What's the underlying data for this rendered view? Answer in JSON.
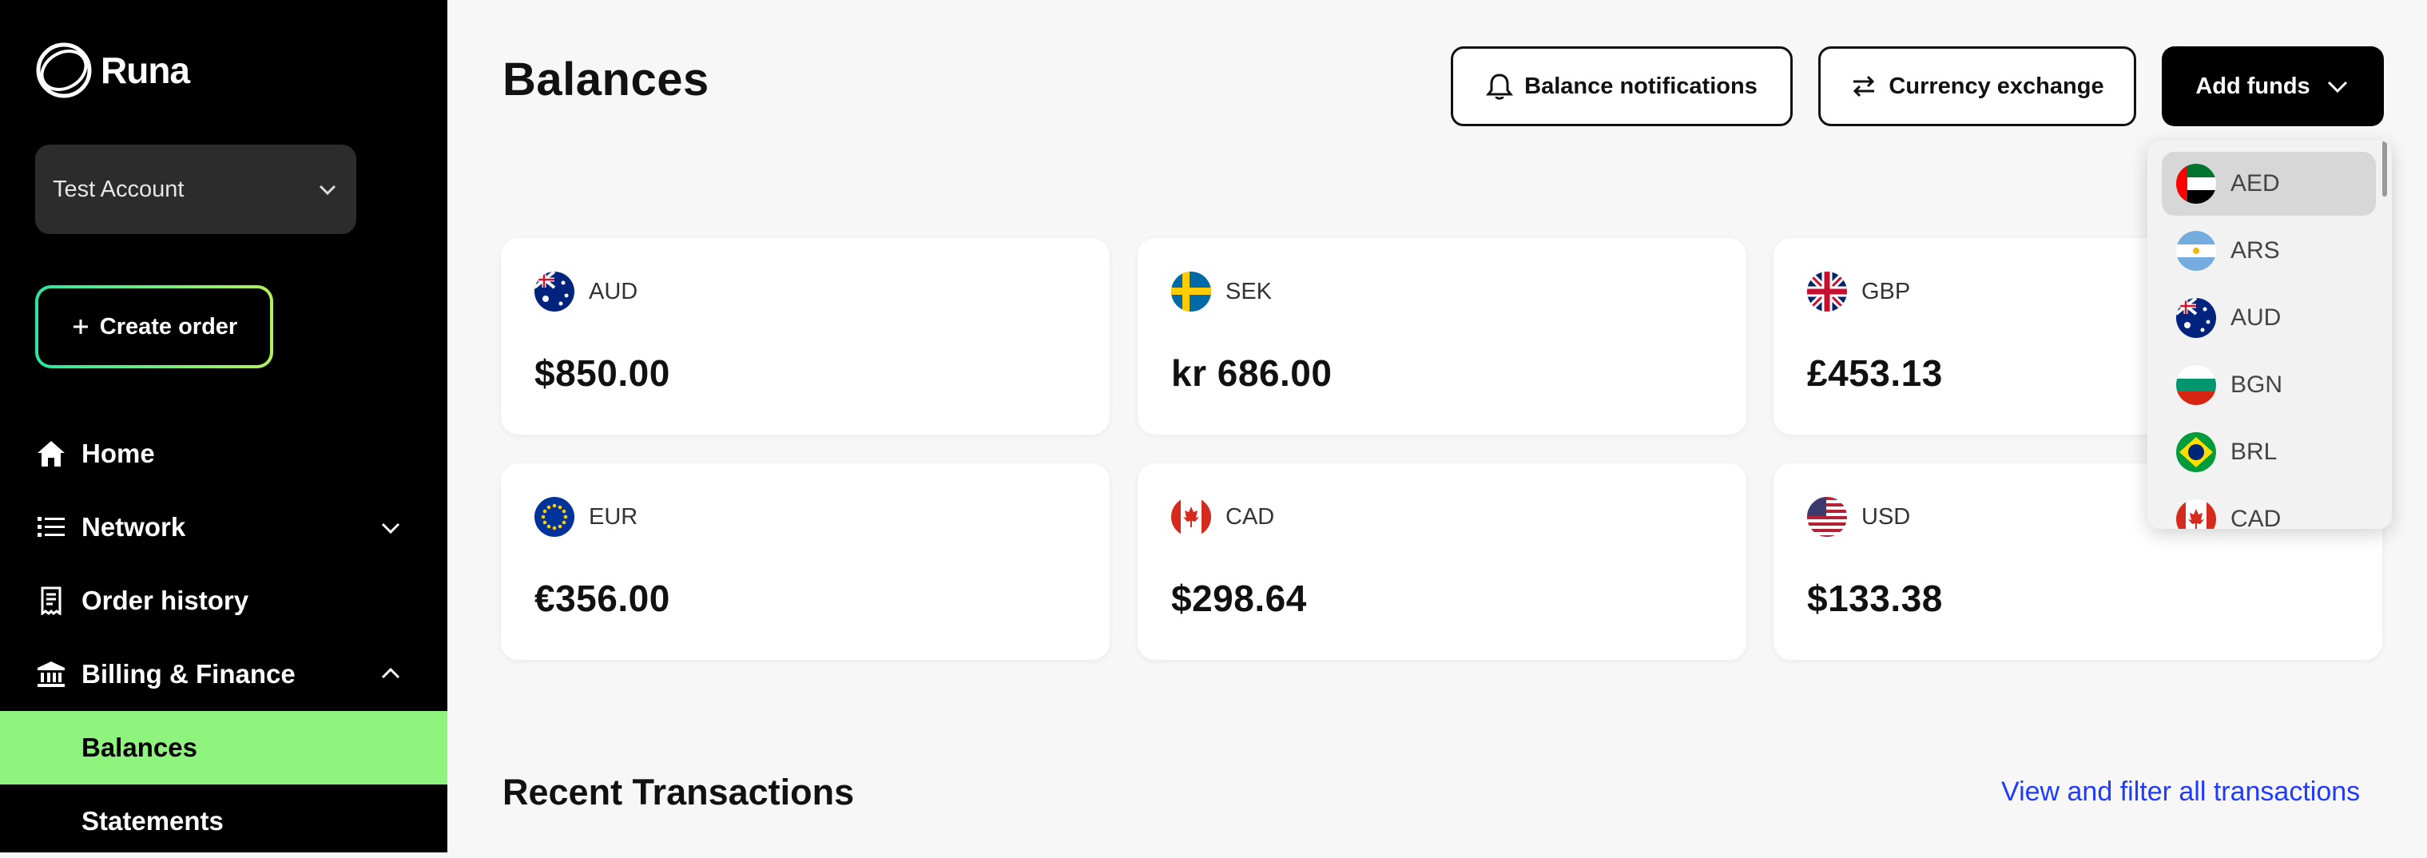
{
  "brand": {
    "name": "Runa"
  },
  "account": {
    "selected": "Test Account"
  },
  "sidebar": {
    "create_label": "Create order",
    "items": [
      {
        "label": "Home"
      },
      {
        "label": "Network"
      },
      {
        "label": "Order history"
      },
      {
        "label": "Billing & Finance"
      },
      {
        "label": "Balances"
      },
      {
        "label": "Statements"
      }
    ]
  },
  "header": {
    "title": "Balances",
    "notifications_label": "Balance notifications",
    "exchange_label": "Currency exchange",
    "add_funds_label": "Add funds"
  },
  "balances": [
    {
      "code": "AUD",
      "amount": "$850.00"
    },
    {
      "code": "SEK",
      "amount": "kr 686.00"
    },
    {
      "code": "GBP",
      "amount": "£453.13"
    },
    {
      "code": "EUR",
      "amount": "€356.00"
    },
    {
      "code": "CAD",
      "amount": "$298.64"
    },
    {
      "code": "USD",
      "amount": "$133.38"
    }
  ],
  "dropdown": {
    "options": [
      "AED",
      "ARS",
      "AUD",
      "BGN",
      "BRL",
      "CAD"
    ],
    "selected": "AED"
  },
  "transactions": {
    "title": "Recent Transactions",
    "view_all_label": "View and filter all transactions"
  },
  "colors": {
    "sidebar_bg": "#000000",
    "active_nav": "#8ef47e",
    "link": "#1f3bff",
    "create_gradient_start": "#2be6a0",
    "create_gradient_end": "#b4f05c"
  }
}
